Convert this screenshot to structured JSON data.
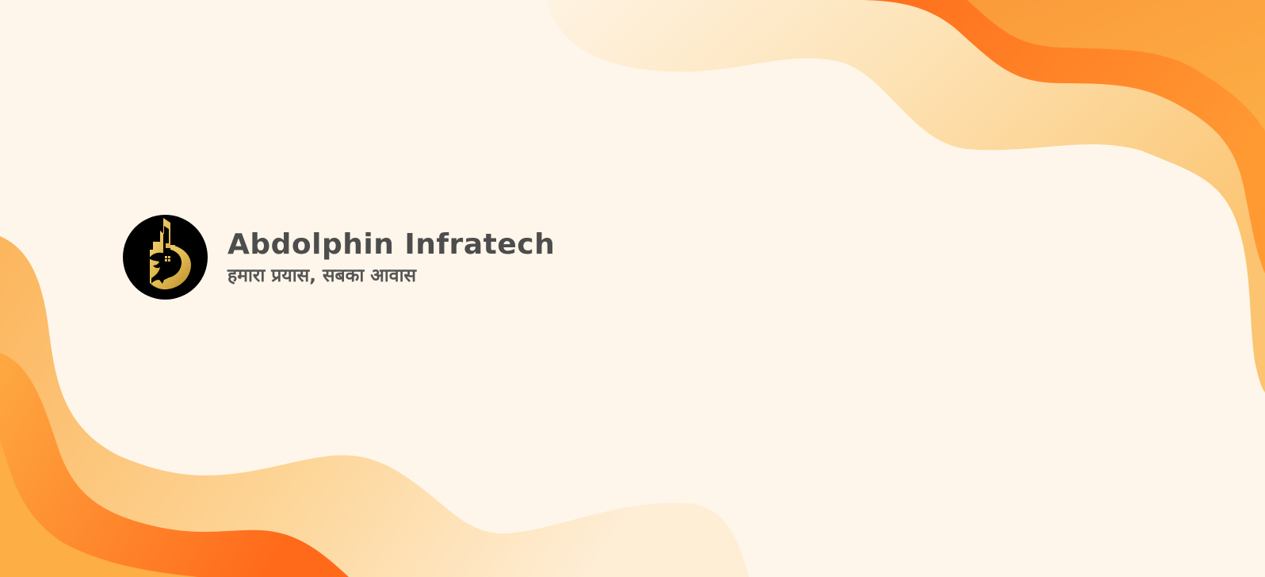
{
  "company": {
    "name": "Abdolphin Infratech",
    "tagline": "हमारा प्रयास, सबका आवास"
  },
  "logo": {
    "icon": "building-dolphin-logo-icon",
    "background_color": "#000000",
    "gold_color": "#e6c45c"
  },
  "theme": {
    "background": "#fef6ea",
    "wave_light": "#fde3b6",
    "wave_mid": "#fcb55c",
    "wave_dark": "#ff6f1f",
    "text": "#4d4d4d"
  }
}
